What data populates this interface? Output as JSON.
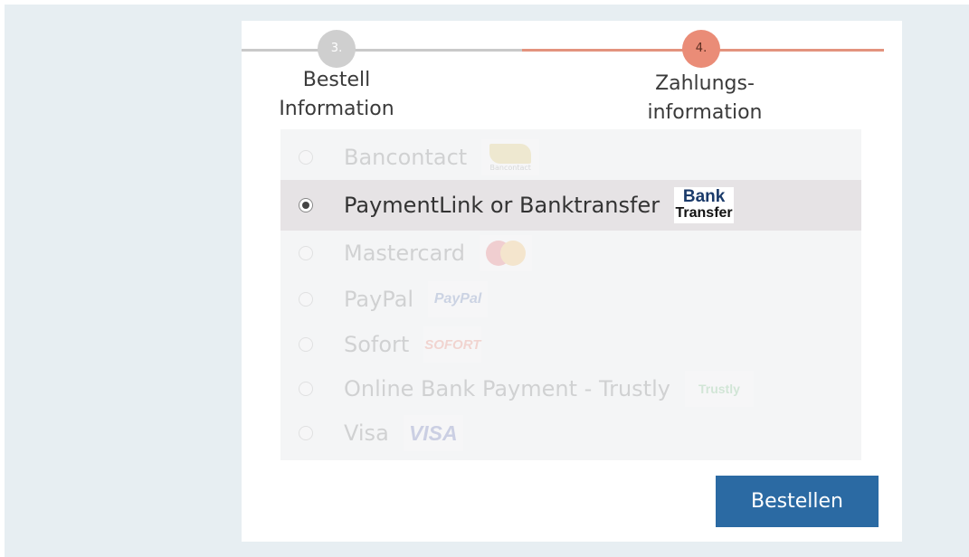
{
  "steps": [
    {
      "number": "3.",
      "label": "Bestell\nInformation"
    },
    {
      "number": "4.",
      "label": "Zahlungs-\ninformation"
    }
  ],
  "payment_methods": [
    {
      "label": "Bancontact",
      "logo_text": "Bancontact",
      "selected": false
    },
    {
      "label": "PaymentLink or Banktransfer",
      "logo_text_1": "Bank",
      "logo_text_2": "Transfer",
      "selected": true
    },
    {
      "label": "Mastercard",
      "logo_icon": "mastercard-logo",
      "selected": false
    },
    {
      "label": "PayPal",
      "logo_text": "PayPal",
      "selected": false
    },
    {
      "label": "Sofort",
      "logo_text": "SOFORT",
      "selected": false
    },
    {
      "label": "Online Bank Payment - Trustly",
      "logo_text": "Trustly",
      "selected": false
    },
    {
      "label": "Visa",
      "logo_text": "VISA",
      "selected": false
    }
  ],
  "order_button": {
    "label": "Bestellen"
  },
  "colors": {
    "accent_red": "#e3937e",
    "button_blue": "#2b6aa3",
    "background": "#e7eef2"
  }
}
